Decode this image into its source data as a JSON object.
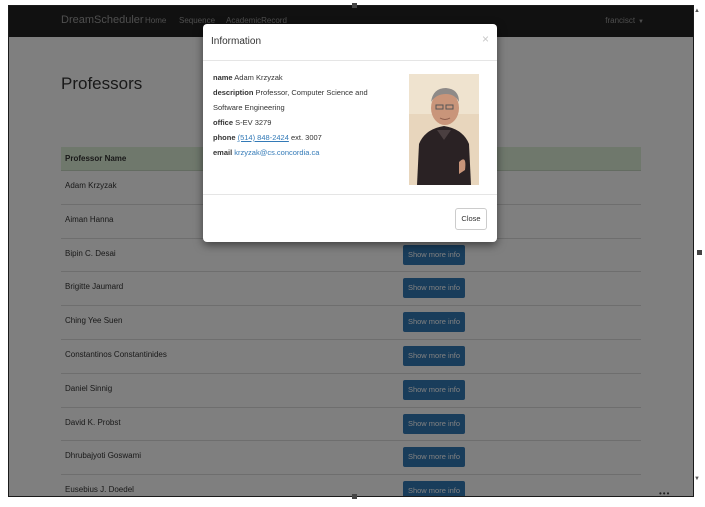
{
  "navbar": {
    "brand": "DreamScheduler",
    "links": [
      "Home",
      "Sequence",
      "AcademicRecord"
    ],
    "user": "francisct"
  },
  "page": {
    "title": "Professors",
    "table_header": "Professor Name",
    "more_button_label": "Show more info",
    "professors": [
      "Adam Krzyzak",
      "Aiman Hanna",
      "Bipin C. Desai",
      "Brigitte Jaumard",
      "Ching Yee Suen",
      "Constantinos Constantinides",
      "Daniel Sinnig",
      "David K. Probst",
      "Dhrubajyoti Goswami",
      "Eusebius J. Doedel"
    ]
  },
  "modal": {
    "title": "Information",
    "close_x": "×",
    "name_label": "name",
    "name": "Adam Krzyzak",
    "description_label": "description",
    "description_1": "Professor, Computer Science and",
    "description_2": "Software Engineering",
    "office_label": "office",
    "office": "S-EV 3279",
    "phone_label": "phone",
    "phone_number": "(514) 848-2424",
    "phone_ext": "ext. 3007",
    "email_label": "email",
    "email": "krzyzak@cs.concordia.ca",
    "close_button": "Close"
  },
  "colors": {
    "navbar_bg": "#222222",
    "table_header_bg": "#dff0d8",
    "button_primary": "#337ab7",
    "link": "#337ab7"
  }
}
